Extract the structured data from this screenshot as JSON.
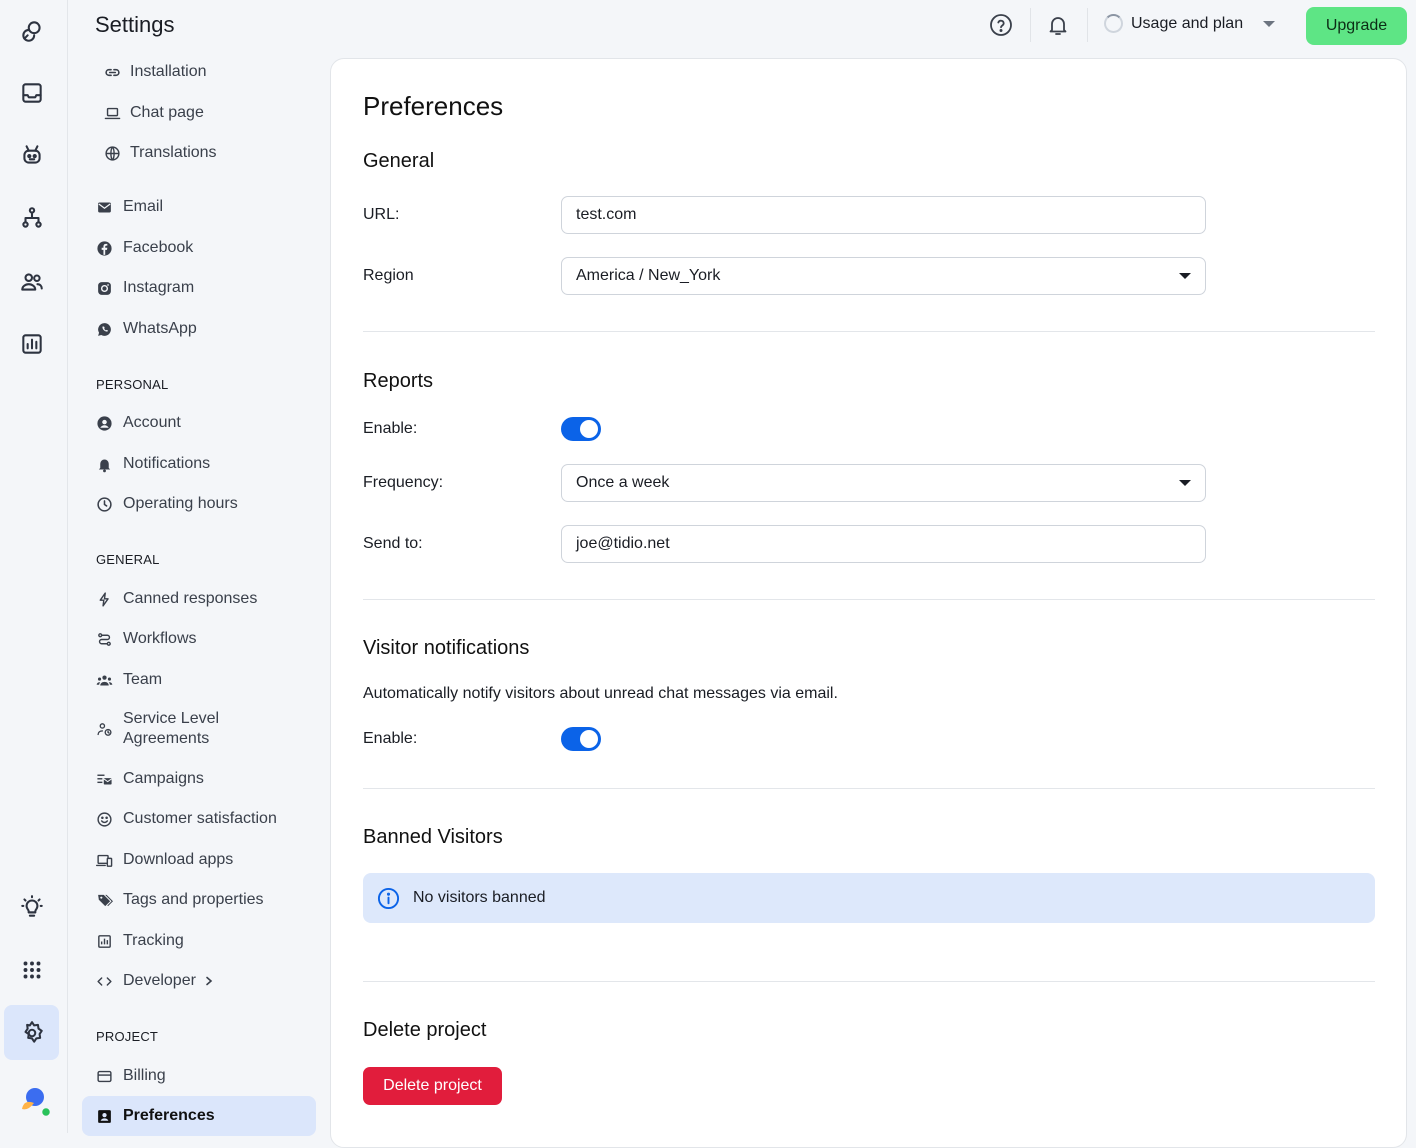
{
  "rail": {
    "items": [
      "home-icon",
      "inbox-icon",
      "bot-icon",
      "flows-icon",
      "contacts-icon",
      "analytics-icon",
      "lightbulb-icon",
      "apps-grid-icon",
      "gear-icon"
    ]
  },
  "sidebar": {
    "title": "Settings",
    "channels": [
      {
        "label": "Installation",
        "icon": "link-icon"
      },
      {
        "label": "Chat page",
        "icon": "laptop-icon"
      },
      {
        "label": "Translations",
        "icon": "globe-icon"
      },
      {
        "label": "Email",
        "icon": "mail-icon"
      },
      {
        "label": "Facebook",
        "icon": "facebook-icon"
      },
      {
        "label": "Instagram",
        "icon": "instagram-icon"
      },
      {
        "label": "WhatsApp",
        "icon": "whatsapp-icon"
      }
    ],
    "personal_header": "PERSONAL",
    "personal": [
      {
        "label": "Account",
        "icon": "user-icon"
      },
      {
        "label": "Notifications",
        "icon": "bell-icon"
      },
      {
        "label": "Operating hours",
        "icon": "clock-icon"
      }
    ],
    "general_header": "GENERAL",
    "general": [
      {
        "label": "Canned responses",
        "icon": "bolt-icon"
      },
      {
        "label": "Workflows",
        "icon": "workflow-icon"
      },
      {
        "label": "Team",
        "icon": "team-icon"
      },
      {
        "label": "Service Level Agreements",
        "icon": "sla-icon"
      },
      {
        "label": "Campaigns",
        "icon": "campaign-icon"
      },
      {
        "label": "Customer satisfaction",
        "icon": "smile-icon"
      },
      {
        "label": "Download apps",
        "icon": "devices-icon"
      },
      {
        "label": "Tags and properties",
        "icon": "tag-icon"
      },
      {
        "label": "Tracking",
        "icon": "tracking-icon"
      },
      {
        "label": "Developer",
        "icon": "code-icon"
      }
    ],
    "project_header": "PROJECT",
    "project": [
      {
        "label": "Billing",
        "icon": "card-icon"
      },
      {
        "label": "Preferences",
        "icon": "preferences-icon"
      }
    ]
  },
  "topbar": {
    "usage_label": "Usage and plan",
    "upgrade_label": "Upgrade"
  },
  "main": {
    "title": "Preferences",
    "general": {
      "heading": "General",
      "url_label": "URL:",
      "url_value": "test.com",
      "region_label": "Region",
      "region_value": "America / New_York"
    },
    "reports": {
      "heading": "Reports",
      "enable_label": "Enable:",
      "enabled": true,
      "frequency_label": "Frequency:",
      "frequency_value": "Once a week",
      "send_to_label": "Send to:",
      "send_to_value": "joe@tidio.net"
    },
    "visitor_notifications": {
      "heading": "Visitor notifications",
      "description": "Automatically notify visitors about unread chat messages via email.",
      "enable_label": "Enable:",
      "enabled": true
    },
    "banned": {
      "heading": "Banned Visitors",
      "info_text": "No visitors banned"
    },
    "delete": {
      "heading": "Delete project",
      "button_label": "Delete project"
    }
  },
  "colors": {
    "accent": "#0b63e8",
    "upgrade": "#5ee585",
    "danger": "#e11d3c",
    "active_bg": "#dbe6fb"
  }
}
